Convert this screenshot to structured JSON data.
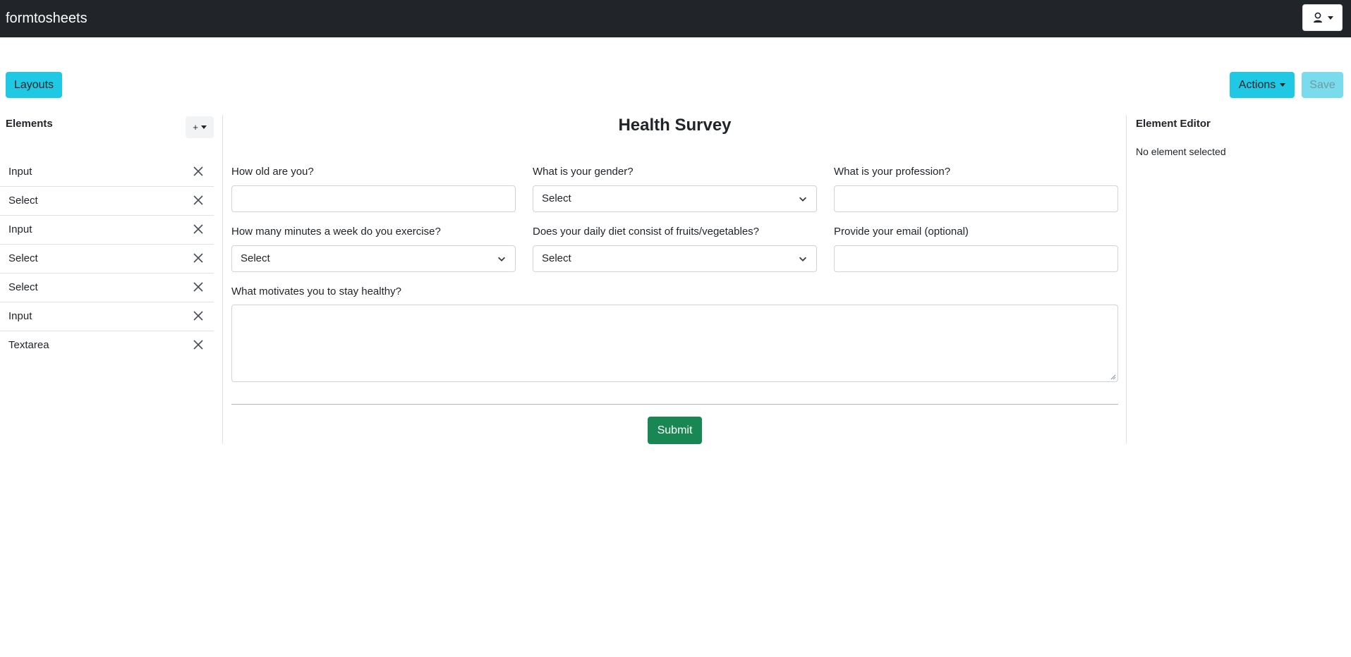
{
  "app": {
    "brand": "formtosheets",
    "user_icon": "user-icon"
  },
  "toolbar": {
    "layouts_label": "Layouts",
    "actions_label": "Actions",
    "save_label": "Save"
  },
  "elements_panel": {
    "title": "Elements",
    "add_label": "+",
    "items": [
      {
        "label": "Input"
      },
      {
        "label": "Select"
      },
      {
        "label": "Input"
      },
      {
        "label": "Select"
      },
      {
        "label": "Select"
      },
      {
        "label": "Input"
      },
      {
        "label": "Textarea"
      }
    ]
  },
  "form": {
    "title": "Health Survey",
    "fields": [
      {
        "label": "How old are you?",
        "type": "input",
        "value": ""
      },
      {
        "label": "What is your gender?",
        "type": "select",
        "value": "Select"
      },
      {
        "label": "What is your profession?",
        "type": "input",
        "value": ""
      },
      {
        "label": "How many minutes a week do you exercise?",
        "type": "select",
        "value": "Select"
      },
      {
        "label": "Does your daily diet consist of fruits/vegetables?",
        "type": "select",
        "value": "Select"
      },
      {
        "label": "Provide your email (optional)",
        "type": "input",
        "value": ""
      },
      {
        "label": "What motivates you to stay healthy?",
        "type": "textarea",
        "value": ""
      }
    ],
    "submit_label": "Submit"
  },
  "editor_panel": {
    "title": "Element Editor",
    "empty_text": "No element selected"
  },
  "colors": {
    "navbar": "#212529",
    "accent": "#1fc8e3",
    "save_disabled": "#79dbec",
    "submit": "#198754"
  }
}
